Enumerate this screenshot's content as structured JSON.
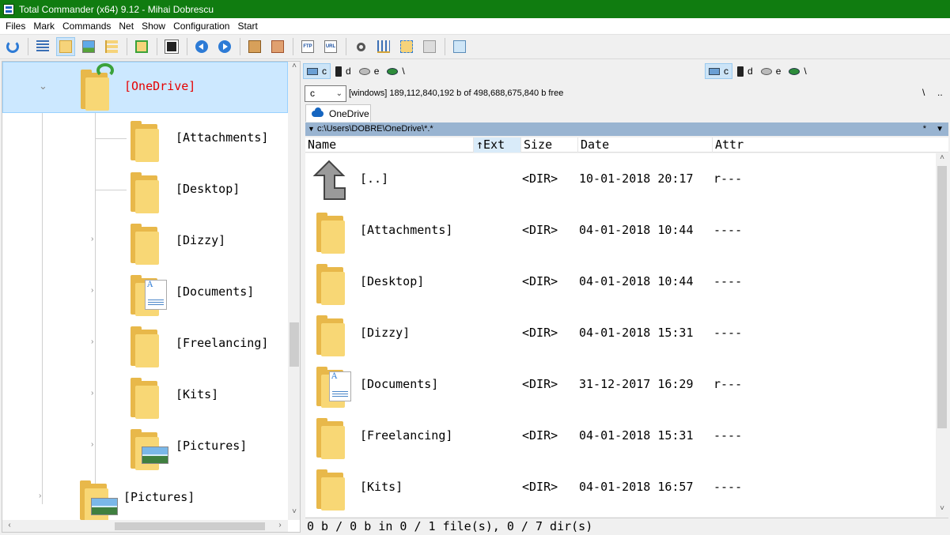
{
  "window": {
    "title": "Total Commander (x64) 9.12 - Mihai Dobrescu"
  },
  "menu": [
    "Files",
    "Mark",
    "Commands",
    "Net",
    "Show",
    "Configuration",
    "Start"
  ],
  "toolbar": {
    "icons": [
      "refresh-icon",
      "brief-view-icon",
      "full-view-icon",
      "thumbnail-view-icon",
      "tree-view-icon",
      "sync-dirs-icon",
      "invert-selection-icon",
      "back-icon",
      "forward-icon",
      "pack-icon",
      "unpack-icon",
      "ftp-connect-icon",
      "url-connect-icon",
      "search-icon",
      "multi-rename-icon",
      "compare-dirs-icon",
      "edit-icon",
      "notepad-icon"
    ],
    "ftp_label": "FTP",
    "url_label": "URL"
  },
  "tree": {
    "root": {
      "label": "[OneDrive]"
    },
    "children": [
      "[Attachments]",
      "[Desktop]",
      "[Dizzy]",
      "[Documents]",
      "[Freelancing]",
      "[Kits]",
      "[Pictures]"
    ],
    "sibling": {
      "label": "[Pictures]"
    }
  },
  "drives_left": [
    {
      "letter": "c",
      "selected": true
    },
    {
      "letter": "d",
      "selected": false
    },
    {
      "letter": "e",
      "selected": false
    },
    {
      "letter": "\\",
      "selected": false
    }
  ],
  "drives_right": [
    {
      "letter": "c",
      "selected": true
    },
    {
      "letter": "d",
      "selected": false
    },
    {
      "letter": "e",
      "selected": false
    },
    {
      "letter": "\\",
      "selected": false
    }
  ],
  "drive_select": {
    "value": "c"
  },
  "disk_info": "[windows]  189,112,840,192 b of 498,688,675,840 b free",
  "dir_buttons": {
    "root": "\\",
    "up": ".."
  },
  "tab": {
    "label": "OneDrive"
  },
  "path": {
    "text": "c:\\Users\\DOBRE\\OneDrive\\*.*",
    "filter": "*"
  },
  "columns": {
    "name": "Name",
    "ext": "↑Ext",
    "size": "Size",
    "date": "Date",
    "attr": "Attr"
  },
  "files": [
    {
      "name": "[..]",
      "size": "<DIR>",
      "date": "10-01-2018 20:17",
      "attr": "r---",
      "icon": "up"
    },
    {
      "name": "[Attachments]",
      "size": "<DIR>",
      "date": "04-01-2018 10:44",
      "attr": "----",
      "icon": "folder"
    },
    {
      "name": "[Desktop]",
      "size": "<DIR>",
      "date": "04-01-2018 10:44",
      "attr": "----",
      "icon": "folder"
    },
    {
      "name": "[Dizzy]",
      "size": "<DIR>",
      "date": "04-01-2018 15:31",
      "attr": "----",
      "icon": "folder"
    },
    {
      "name": "[Documents]",
      "size": "<DIR>",
      "date": "31-12-2017 16:29",
      "attr": "r---",
      "icon": "documents"
    },
    {
      "name": "[Freelancing]",
      "size": "<DIR>",
      "date": "04-01-2018 15:31",
      "attr": "----",
      "icon": "folder"
    },
    {
      "name": "[Kits]",
      "size": "<DIR>",
      "date": "04-01-2018 16:57",
      "attr": "----",
      "icon": "folder"
    }
  ],
  "status": "0 b / 0 b in 0 / 1 file(s), 0 / 7 dir(s)",
  "colors": {
    "titlebar": "#107c10",
    "selection": "#cce8ff",
    "pathbar": "#99b4d1",
    "folder": "#f8d775",
    "root_label": "#e60000"
  }
}
